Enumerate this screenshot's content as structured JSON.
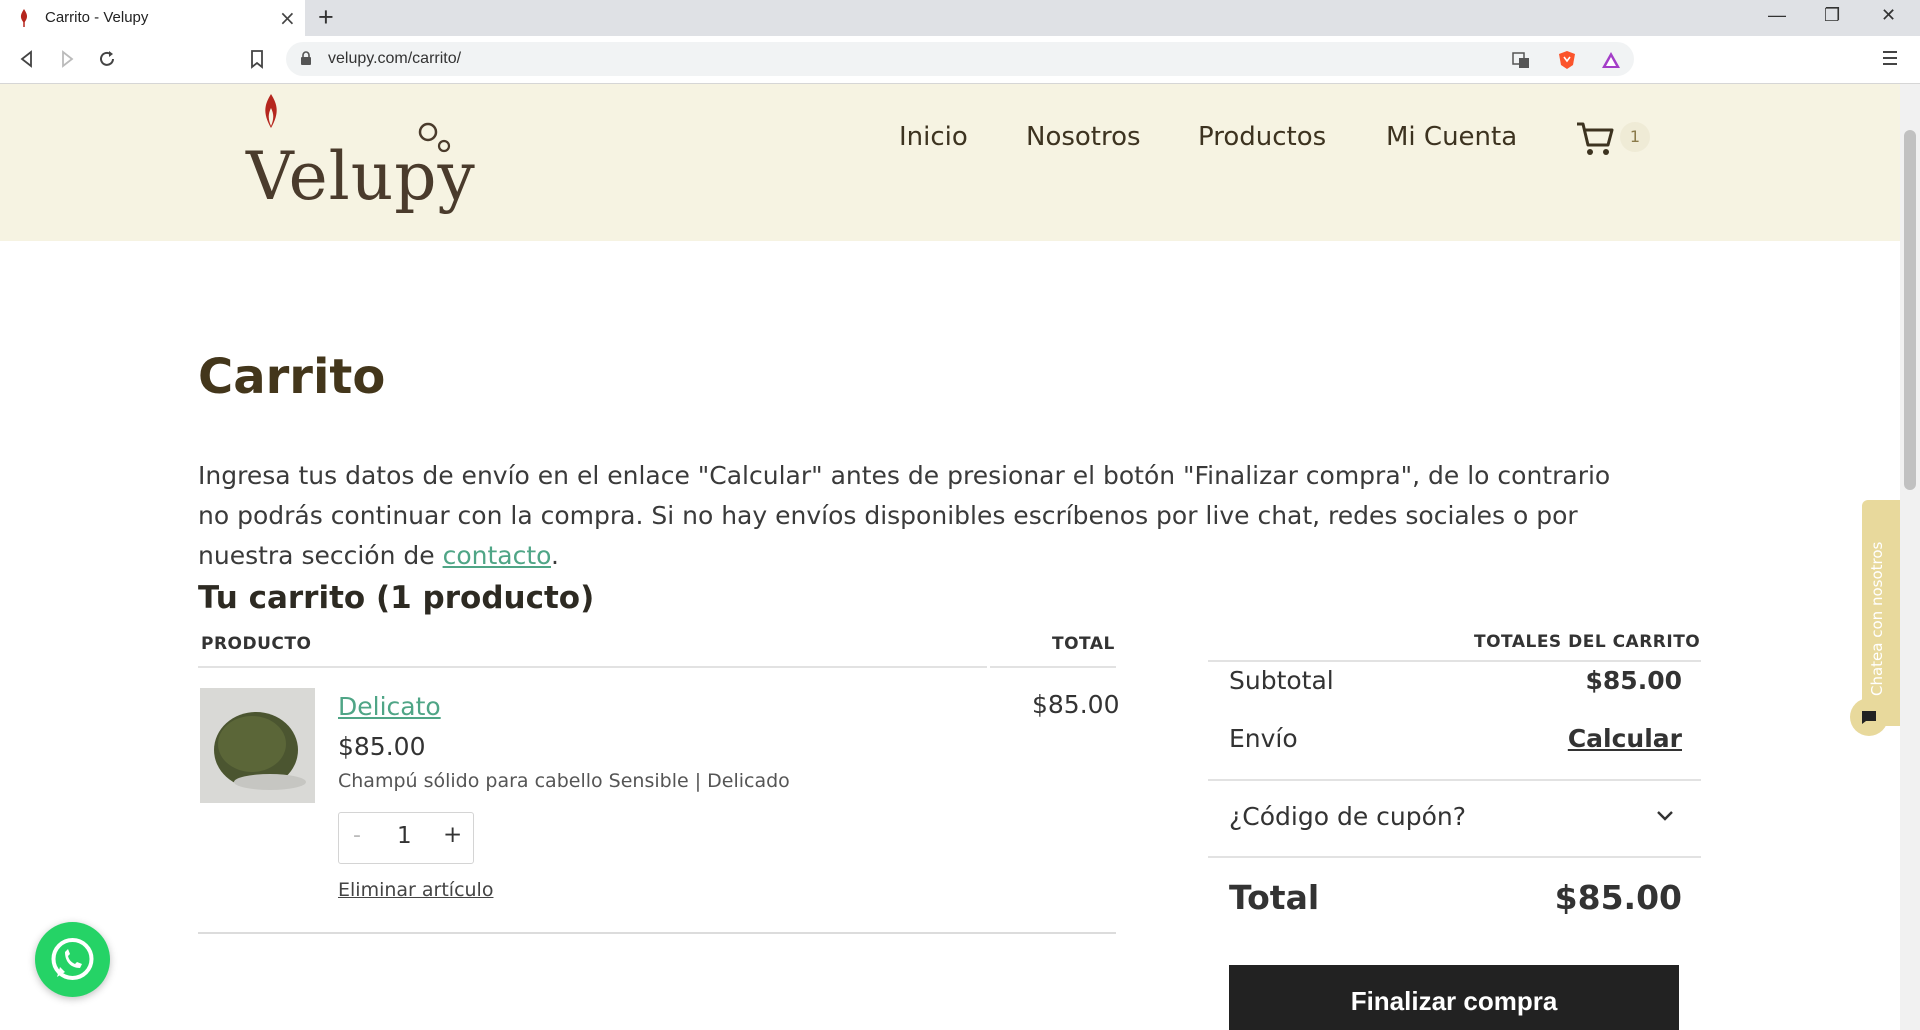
{
  "browser": {
    "tab_title": "Carrito - Velupy",
    "url": "velupy.com/carrito/",
    "new_tab": "+",
    "tab_close": "×",
    "window_controls": {
      "minimize": "—",
      "restore": "❐",
      "close": "✕"
    }
  },
  "header": {
    "logo_text": "Velupy",
    "nav": [
      "Inicio",
      "Nosotros",
      "Productos",
      "Mi Cuenta"
    ],
    "cart_count": "1"
  },
  "page": {
    "title": "Carrito",
    "notice_text": "Ingresa tus datos de envío en el enlace \"Calcular\" antes de presionar el botón \"Finalizar compra\", de lo contrario no podrás continuar con la compra. Si no hay envíos disponibles escríbenos por live chat, redes sociales o por nuestra sección de ",
    "notice_link": "contacto",
    "notice_end": "."
  },
  "cart": {
    "heading": "Tu carrito (1 producto)",
    "col_product": "PRODUCTO",
    "col_total": "TOTAL",
    "item": {
      "name": "Delicato",
      "price": "$85.00",
      "description": "Champú sólido para cabello Sensible | Delicado",
      "qty_minus": "-",
      "quantity": "1",
      "qty_plus": "+",
      "remove_label": "Eliminar artículo",
      "line_total": "$85.00"
    }
  },
  "totals": {
    "heading": "TOTALES DEL CARRITO",
    "subtotal_label": "Subtotal",
    "subtotal_value": "$85.00",
    "shipping_label": "Envío",
    "shipping_action": "Calcular",
    "coupon_label": "¿Código de cupón?",
    "total_label": "Total",
    "total_value": "$85.00",
    "checkout_label": "Finalizar compra"
  },
  "widgets": {
    "chat_tab_label": "Chatea con nosotros"
  },
  "colors": {
    "header_bg": "#f6f3e2",
    "link_green": "#4fa586",
    "title_brown": "#43361b",
    "whatsapp": "#25d366",
    "chat_tab": "#e8d99c"
  },
  "icons": [
    "back-icon",
    "forward-icon",
    "reload-icon",
    "bookmark-icon",
    "lock-icon",
    "translate-icon",
    "brave-shield-icon",
    "brave-rewards-icon",
    "menu-icon",
    "cart-icon",
    "chevron-down-icon",
    "chat-icon",
    "whatsapp-icon"
  ]
}
